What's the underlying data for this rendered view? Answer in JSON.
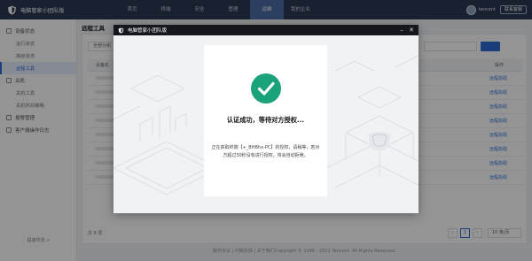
{
  "app": {
    "title": "电脑管家小团队版",
    "brand_color": "#2b3a55",
    "accent_color": "#2d6bd6",
    "success_color": "#1aa37a"
  },
  "topnav": {
    "items": [
      {
        "label": "首页",
        "active": false
      },
      {
        "label": "终端",
        "active": false
      },
      {
        "label": "安全",
        "active": false
      },
      {
        "label": "管理",
        "active": false
      },
      {
        "label": "运维",
        "active": true
      },
      {
        "label": "我的企业",
        "active": false
      }
    ]
  },
  "user": {
    "name": "tencent",
    "mail_button": "联系客服",
    "avatar_icon": "avatar"
  },
  "sidebar": {
    "groups": [
      {
        "label": "设备状态",
        "icon": "monitor-icon",
        "items": [
          "运行状态",
          "高级状态",
          "远程工具"
        ],
        "active_item": "远程工具"
      },
      {
        "label": "关机",
        "icon": "power-icon",
        "items": [
          "关机工具",
          "关机时间策略"
        ]
      },
      {
        "label": "报警管理",
        "icon": "alarm-icon",
        "items": []
      },
      {
        "label": "客户端操作日志",
        "icon": "log-icon",
        "items": []
      }
    ],
    "footer": "提速市场 >"
  },
  "page": {
    "title": "远程工具",
    "filter_label": "全部分组",
    "columns": [
      "设备名",
      "操作"
    ],
    "row_action": "远程协助",
    "total": "共 8 项",
    "current_page": "1",
    "page_size": "10 条/页"
  },
  "footer": {
    "text": "服务协议 | 问题反馈 | 关于我们Copyright © 1998 - 2021 Tencent. All Rights Reserved."
  },
  "dialog": {
    "title": "电脑管家小团队版",
    "status": "认证成功，等待对方授权...",
    "description": "正在获取终端【+_BHBhx-PC】的授权，请稍等，若对方超过30秒没有进行授权，将会自动拒绝。",
    "close_icon": "close",
    "minimize_icon": "minimize"
  }
}
